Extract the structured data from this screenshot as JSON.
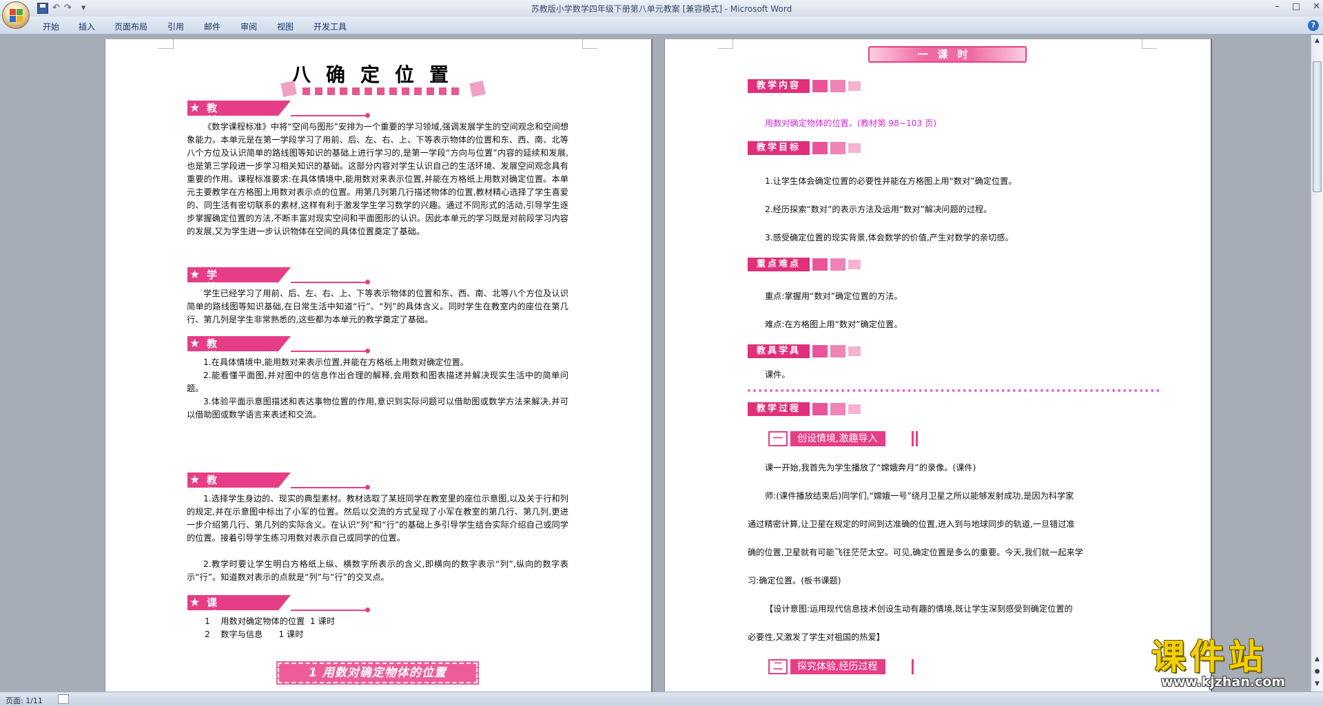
{
  "window": {
    "title": "苏教版小学数学四年级下册第八单元教案 [兼容模式] - Microsoft Word",
    "min": "–",
    "max": "□",
    "close": "✕"
  },
  "qat": {
    "undo": "↶",
    "redo": "↷",
    "more": "▾"
  },
  "ribbon": {
    "tabs": [
      "开始",
      "插入",
      "页面布局",
      "引用",
      "邮件",
      "审阅",
      "视图",
      "开发工具"
    ],
    "help": "?"
  },
  "left_page": {
    "title": "八确定位置",
    "sections": [
      {
        "heading": "教材分析",
        "paragraphs": [
          "《数学课程标准》中将“空间与图形”安排为一个重要的学习领域,强调发展学生的空间观念和空间想象能力。本单元是在第一学段学习了用前、后、左、右、上、下等表示物体的位置和东、西、南、北等八个方位及认识简单的路线图等知识的基础上进行学习的,是第一学段“方向与位置”内容的延续和发展,也是第三学段进一步学习相关知识的基础。这部分内容对学生认识自己的生活环境、发展空间观念具有重要的作用。课程标准要求:在具体情境中,能用数对来表示位置,并能在方格纸上用数对确定位置。本单元主要教学在方格图上用数对表示点的位置。用第几列第几行描述物体的位置,教材精心选择了学生喜爱的、同生活有密切联系的素材,这样有利于激发学生学习数学的兴趣。通过不同形式的活动,引导学生逐步掌握确定位置的方法,不断丰富对现实空间和平面图形的认识。因此本单元的学习既是对前段学习内容的发展,又为学生进一步认识物体在空间的具体位置奠定了基础。"
        ]
      },
      {
        "heading": "学情分析",
        "paragraphs": [
          "学生已经学习了用前、后、左、右、上、下等表示物体的位置和东、西、南、北等八个方位及认识简单的路线图等知识基础,在日常生活中知道“行”、“列”的具体含义。同时学生在教室内的座位在第几行、第几列是学生非常熟悉的,这些都为本单元的教学奠定了基础。"
        ]
      },
      {
        "heading": "教学要求",
        "paragraphs": [
          "1.在具体情境中,能用数对来表示位置,并能在方格纸上用数对确定位置。",
          "2.能看懂平面图,并对图中的信息作出合理的解释,会用数和图表描述并解决现实生活中的简单问题。",
          "3.体验平面示意图描述和表达事物位置的作用,意识到实际问题可以借助图或数学方法来解决,并可以借助图或数学语言来表述和交流。"
        ]
      },
      {
        "heading": "教学建议",
        "paragraphs": [
          "1.选择学生身边的、现实的典型素材。教材选取了某班同学在教室里的座位示意图,以及关于行和列的规定,并在示意图中标出了小军的位置。然后以交流的方式呈现了小军在教室的第几行、第几列,更进一步介绍第几行、第几列的实际含义。在认识“列”和“行”的基础上多引导学生结合实际介绍自己或同学的位置。接着引导学生练习用数对表示自己或同学的位置。",
          "2.教学时要让学生明白方格纸上纵、横数字所表示的含义,即横向的数字表示“列”,纵向的数字表示“行”。知道数对表示的点就是“列”与“行”的交叉点。"
        ]
      },
      {
        "heading": "课时安排",
        "paragraphs": [
          "1    用数对确定物体的位置  1 课时",
          "2    数字与信息      1 课时"
        ]
      }
    ],
    "lesson_bar": "1 用数对确定物体的位置"
  },
  "right_page": {
    "title": "一课时",
    "blocks": [
      {
        "tag": "教学内容",
        "lines": [
          "用数对确定物体的位置。(教材第 98~103 页)"
        ]
      },
      {
        "tag": "教学目标",
        "lines": [
          "1.让学生体会确定位置的必要性并能在方格图上用“数对”确定位置。",
          "2.经历探索“数对”的表示方法及运用“数对”解决问题的过程。",
          "3.感受确定位置的现实背景,体会数学的价值,产生对数学的亲切感。"
        ]
      },
      {
        "tag": "重点难点",
        "lines": [
          "重点:掌握用“数对”确定位置的方法。",
          "难点:在方格图上用“数对”确定位置。"
        ]
      },
      {
        "tag": "教具学具",
        "lines": [
          "课件。"
        ]
      },
      {
        "tag": "教学过程",
        "lines": []
      }
    ],
    "step1": {
      "num": "一",
      "title": "创设情境,激趣导入"
    },
    "process_lines": [
      "课一开始,我首先为学生播放了“嫦娥奔月”的录像。(课件)",
      "师:(课件播放结束后)同学们,“嫦娥一号”绕月卫星之所以能够发射成功,是因为科学家",
      "通过精密计算,让卫星在规定的时间到达准确的位置,进入到与地球同步的轨道,一旦错过准",
      "确的位置,卫星就有可能飞往茫茫太空。可见,确定位置是多么的重要。今天,我们就一起来学",
      "习:确定位置。(板书课题)",
      "【设计意图:运用现代信息技术创设生动有趣的情境,既让学生深刻感受到确定位置的",
      "必要性,又激发了学生对祖国的热爱】"
    ],
    "step2": {
      "num": "二",
      "title": "探究体验,经历过程"
    }
  },
  "status": {
    "page": "页面: 1/11"
  },
  "watermark": {
    "cn": "课件站",
    "url": "www.kjzhan.com"
  },
  "colors": {
    "accent": "#e53e86",
    "pink_text": "#d02bd0",
    "watermark": "#f3d000"
  }
}
